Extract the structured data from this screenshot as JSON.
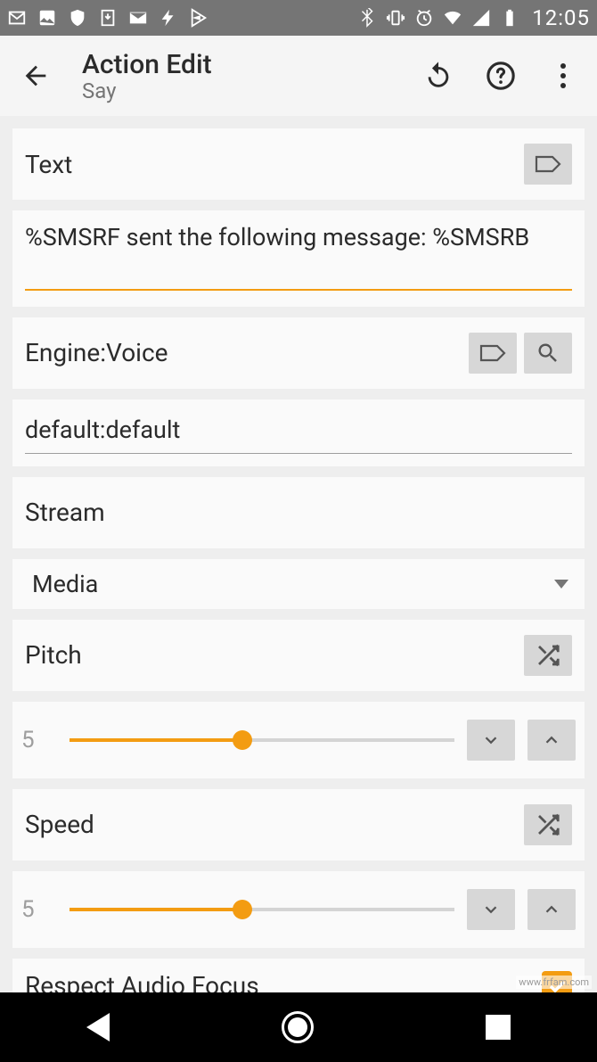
{
  "status": {
    "clock": "12:05"
  },
  "appbar": {
    "title": "Action Edit",
    "subtitle": "Say"
  },
  "text_section": {
    "label": "Text",
    "value": "%SMSRF sent the following message: %SMSRB"
  },
  "engine_section": {
    "label": "Engine:Voice",
    "value": "default:default"
  },
  "stream_section": {
    "label": "Stream",
    "selected": "Media"
  },
  "pitch": {
    "label": "Pitch",
    "value": "5",
    "percent": 45
  },
  "speed": {
    "label": "Speed",
    "value": "5",
    "percent": 45
  },
  "respect_audio": {
    "label": "Respect Audio Focus",
    "checked": true
  },
  "watermark": "www.frfam.com"
}
